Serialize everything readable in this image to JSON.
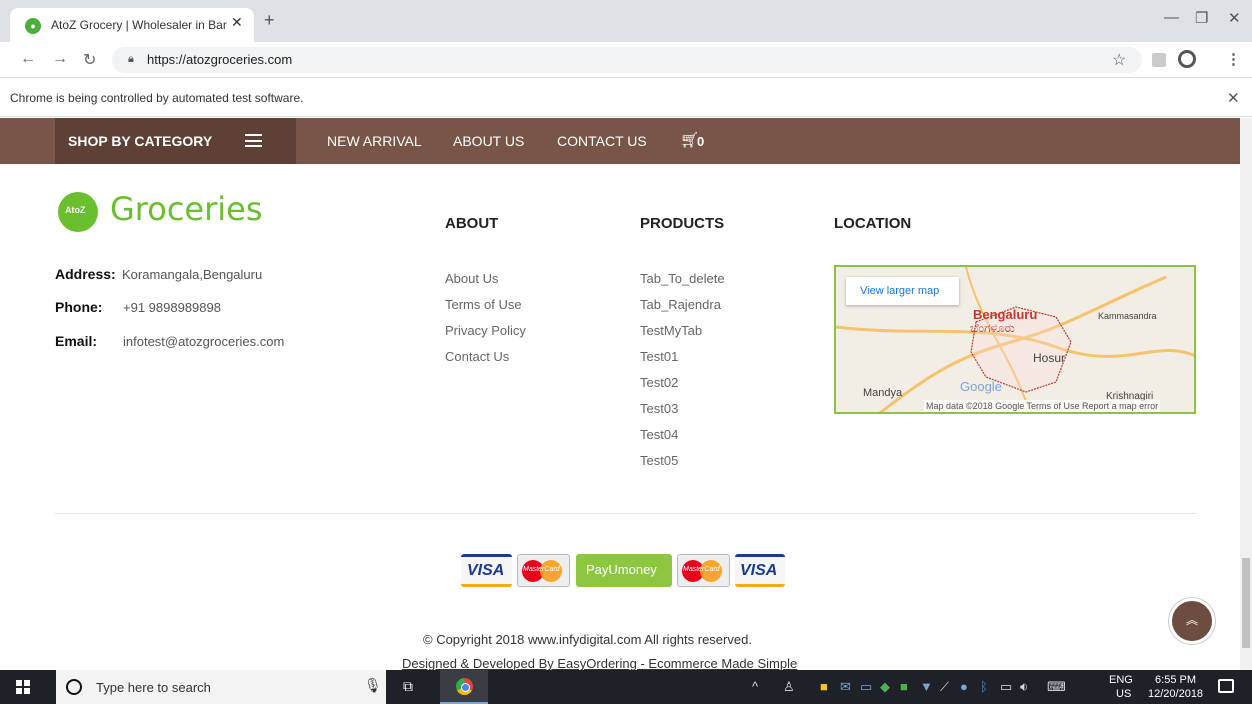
{
  "browser": {
    "tab_title": "AtoZ Grocery | Wholesaler in Ban",
    "tab_close": "✕",
    "new_tab": "+",
    "url": "https://atozgroceries.com",
    "infobar_text": "Chrome is being controlled by automated test software.",
    "infobar_close": "✕"
  },
  "nav": {
    "shop_by_category": "SHOP BY CATEGORY",
    "links": [
      "NEW ARRIVAL",
      "ABOUT US",
      "CONTACT US"
    ],
    "cart_count": "0"
  },
  "logo": {
    "text": "Groceries",
    "badge": "AtoZ"
  },
  "contact": {
    "address_label": "Address:",
    "address_value": "Koramangala,Bengaluru",
    "phone_label": "Phone:",
    "phone_value": "+91 9898989898",
    "email_label": "Email:",
    "email_value": "infotest@atozgroceries.com"
  },
  "about": {
    "heading": "ABOUT",
    "links": [
      "About Us",
      "Terms of Use",
      "Privacy Policy",
      "Contact Us"
    ]
  },
  "products": {
    "heading": "PRODUCTS",
    "links": [
      "Tab_To_delete",
      "Tab_Rajendra",
      "TestMyTab",
      "Test01",
      "Test02",
      "Test03",
      "Test04",
      "Test05"
    ]
  },
  "location": {
    "heading": "LOCATION",
    "view_larger_map": "View larger map",
    "map_city": "Bengaluru",
    "map_city_kn": "ಬೆಂಗಳೂರು",
    "map_places": [
      "Hosur",
      "Mandya",
      "Kammasandra",
      "Krishnagiri"
    ],
    "map_google": "Google",
    "map_footer": "Map data ©2018 Google   Terms of Use   Report a map error"
  },
  "payments": [
    "VISA",
    "MasterCard",
    "PayUmoney",
    "MasterCard",
    "VISA"
  ],
  "footer": {
    "copyright": "© Copyright 2018 www.infydigital.com All rights reserved.",
    "designed": "Designed & Developed By EasyOrdering - Ecommerce Made Simple"
  },
  "taskbar": {
    "search_placeholder": "Type here to search",
    "lang_top": "ENG",
    "lang_bottom": "US",
    "time": "6:55 PM",
    "date": "12/20/2018"
  },
  "colors": {
    "nav_bg": "#795548",
    "nav_dark": "#5f4037",
    "brand_green": "#6abf2e"
  }
}
